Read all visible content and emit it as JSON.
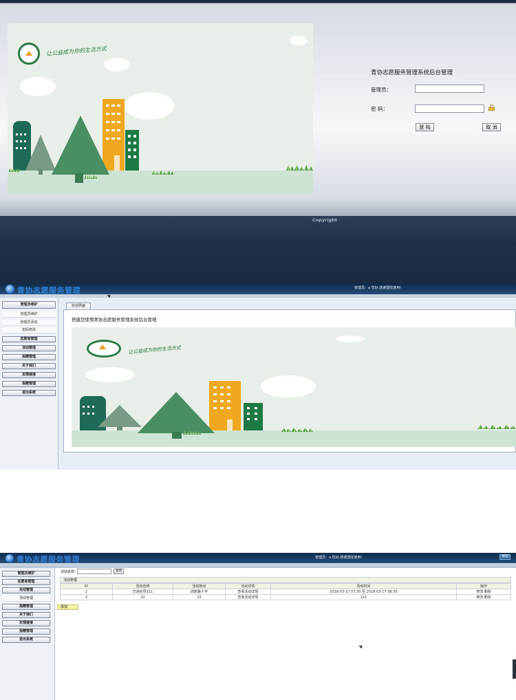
{
  "login": {
    "title": "青协志愿服务管理系统后台管理",
    "username_label": "管理员：",
    "password_label": "密 码：",
    "username_value": "",
    "password_value": "",
    "login_button": "登 陆",
    "cancel_button": "取 消",
    "copyright": "Copyright",
    "slogan": "让公益成为你的生活方式"
  },
  "admin1": {
    "brand": "青协志愿服务管理",
    "top_message": "管理员：a 您好,感谢登陆使用!",
    "menu": [
      "管理员维护",
      "管理员维护",
      "管理员添加",
      "密码修改",
      "志愿者管理",
      "活动管理",
      "捐赠管理",
      "关于我们",
      "友情链接",
      "捐赠管理",
      "退出系统"
    ],
    "tab": "欢迎界面",
    "welcome": "搭建您使用青协志愿服务管理系统后台管理",
    "slogan": "让公益成为你的生活方式"
  },
  "admin2": {
    "brand": "青协志愿服务管理",
    "top_message": "管理员：a 您好,感谢登陆使用!",
    "top_right_button": "退出",
    "menu": [
      "管理员维护",
      "志愿者管理",
      "活动管理",
      "活动管理",
      "捐赠管理",
      "关于我们",
      "友情链接",
      "捐赠管理",
      "退出系统"
    ],
    "search_label": "活动名称：",
    "search_value": "",
    "search_button": "查询",
    "table_title": "活动管理",
    "columns": [
      "ID",
      "活动名称",
      "活动地点",
      "活动详情",
      "活动时间",
      "操作"
    ],
    "rows": [
      [
        "2",
        "交通劝导111",
        "高新路十字",
        "查看活动详情",
        "2018-03-17 07:30 至 2018-03-17 08:30",
        "修改 删除"
      ],
      [
        "3",
        "22",
        "22",
        "查看活动详情",
        "111",
        "修改 删除"
      ]
    ],
    "add_button": "添加"
  },
  "colors": {
    "nav_dark": "#1f3048",
    "brand_blue": "#2f7ed3",
    "tree_green": "#4a8f63",
    "building_orange": "#f0a820",
    "building_green": "#1e7a45"
  }
}
